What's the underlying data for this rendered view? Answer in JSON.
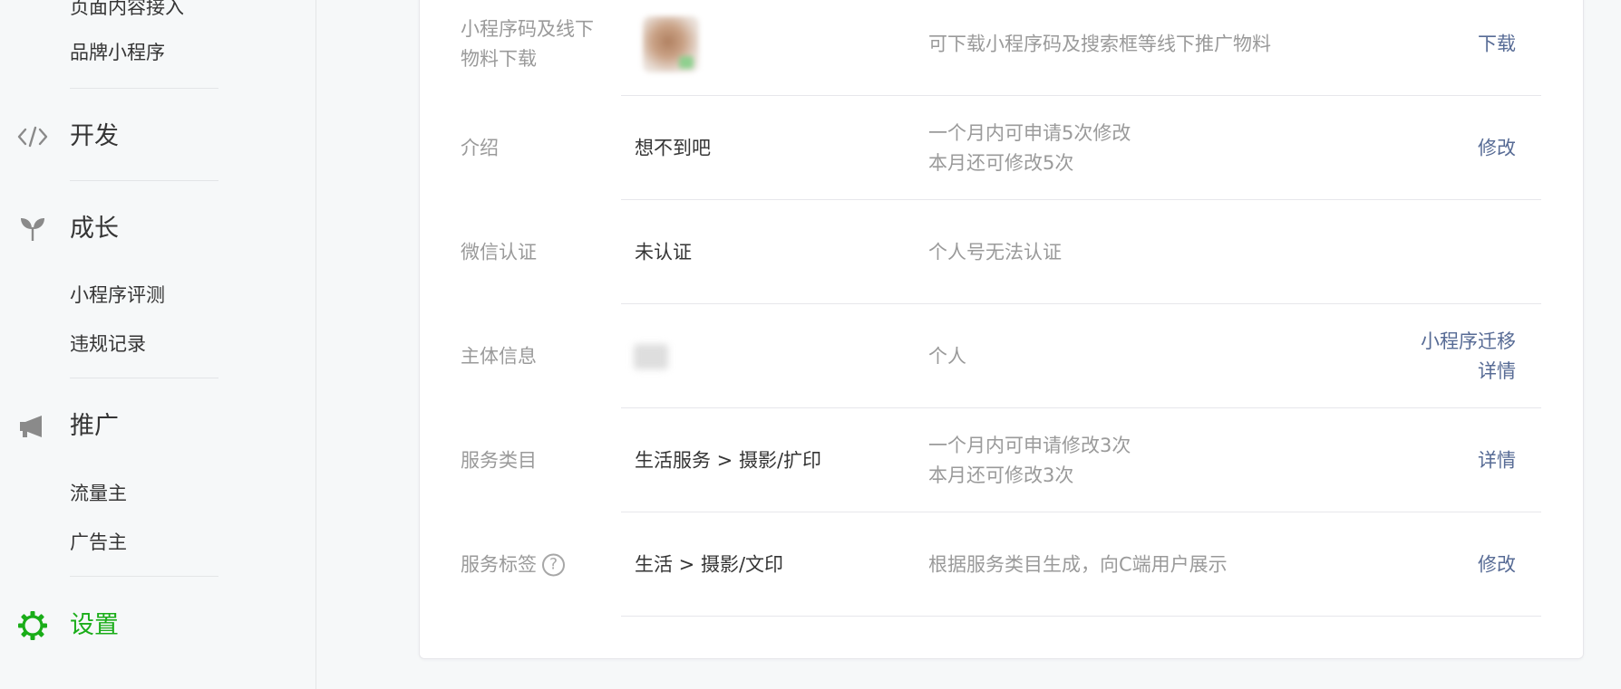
{
  "sidebar": {
    "partial_item": "页面内容接入",
    "sub_brand": "品牌小程序",
    "categories": {
      "develop": {
        "label": "开发",
        "icon": "code-icon"
      },
      "growth": {
        "label": "成长",
        "icon": "sprout-icon"
      },
      "promote": {
        "label": "推广",
        "icon": "megaphone-icon"
      },
      "settings": {
        "label": "设置",
        "icon": "gear-icon"
      }
    },
    "growth_items": [
      "小程序评测",
      "违规记录"
    ],
    "promote_items": [
      "流量主",
      "广告主"
    ],
    "active_color": "#1aad19"
  },
  "rows": {
    "qrcode": {
      "label_line1": "小程序码及线下",
      "label_line2": "物料下载",
      "desc": "可下载小程序码及搜索框等线下推广物料",
      "action": "下载"
    },
    "intro": {
      "label": "介绍",
      "value": "想不到吧",
      "desc_line1": "一个月内可申请5次修改",
      "desc_line2": "本月还可修改5次",
      "action": "修改"
    },
    "wechat_verify": {
      "label": "微信认证",
      "value": "未认证",
      "desc": "个人号无法认证"
    },
    "subject": {
      "label": "主体信息",
      "desc": "个人",
      "action_line1": "小程序迁移",
      "action_line2": "详情"
    },
    "category": {
      "label": "服务类目",
      "value": "生活服务 > 摄影/扩印",
      "desc_line1": "一个月内可申请修改3次",
      "desc_line2": "本月还可修改3次",
      "action": "详情"
    },
    "tags": {
      "label": "服务标签",
      "help": "?",
      "value": "生活 > 摄影/文印",
      "desc": "根据服务类目生成，向C端用户展示",
      "action": "修改"
    }
  },
  "colors": {
    "link": "#576b95",
    "muted": "#9a9a9a",
    "text": "#353535"
  }
}
